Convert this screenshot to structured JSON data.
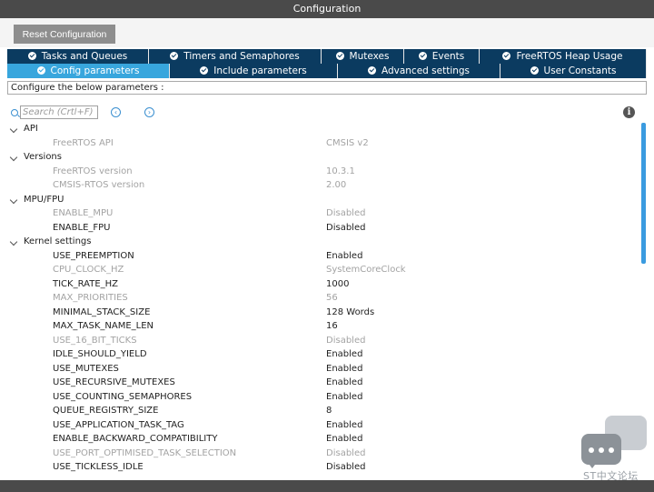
{
  "window": {
    "title": "Configuration"
  },
  "toolbar": {
    "reset_label": "Reset Configuration"
  },
  "tabs_row1": [
    {
      "label": "Tasks and Queues"
    },
    {
      "label": "Timers and Semaphores"
    },
    {
      "label": "Mutexes"
    },
    {
      "label": "Events"
    },
    {
      "label": "FreeRTOS Heap Usage"
    }
  ],
  "tabs_row2": [
    {
      "label": "Config parameters",
      "active": true
    },
    {
      "label": "Include parameters"
    },
    {
      "label": "Advanced settings"
    },
    {
      "label": "User Constants"
    }
  ],
  "info_text": "Configure the below parameters :",
  "search": {
    "placeholder": "Search (Crtl+F)"
  },
  "tree": [
    {
      "type": "group",
      "label": "API"
    },
    {
      "type": "param",
      "name": "FreeRTOS API",
      "value": "CMSIS v2",
      "enabled": false
    },
    {
      "type": "group",
      "label": "Versions"
    },
    {
      "type": "param",
      "name": "FreeRTOS version",
      "value": "10.3.1",
      "enabled": false
    },
    {
      "type": "param",
      "name": "CMSIS-RTOS version",
      "value": "2.00",
      "enabled": false
    },
    {
      "type": "group",
      "label": "MPU/FPU"
    },
    {
      "type": "param",
      "name": "ENABLE_MPU",
      "value": "Disabled",
      "enabled": false
    },
    {
      "type": "param",
      "name": "ENABLE_FPU",
      "value": "Disabled",
      "enabled": true
    },
    {
      "type": "group",
      "label": "Kernel settings"
    },
    {
      "type": "param",
      "name": "USE_PREEMPTION",
      "value": "Enabled",
      "enabled": true
    },
    {
      "type": "param",
      "name": "CPU_CLOCK_HZ",
      "value": "SystemCoreClock",
      "enabled": false
    },
    {
      "type": "param",
      "name": "TICK_RATE_HZ",
      "value": "1000",
      "enabled": true
    },
    {
      "type": "param",
      "name": "MAX_PRIORITIES",
      "value": "56",
      "enabled": false
    },
    {
      "type": "param",
      "name": "MINIMAL_STACK_SIZE",
      "value": "128 Words",
      "enabled": true
    },
    {
      "type": "param",
      "name": "MAX_TASK_NAME_LEN",
      "value": "16",
      "enabled": true
    },
    {
      "type": "param",
      "name": "USE_16_BIT_TICKS",
      "value": "Disabled",
      "enabled": false
    },
    {
      "type": "param",
      "name": "IDLE_SHOULD_YIELD",
      "value": "Enabled",
      "enabled": true
    },
    {
      "type": "param",
      "name": "USE_MUTEXES",
      "value": "Enabled",
      "enabled": true
    },
    {
      "type": "param",
      "name": "USE_RECURSIVE_MUTEXES",
      "value": "Enabled",
      "enabled": true
    },
    {
      "type": "param",
      "name": "USE_COUNTING_SEMAPHORES",
      "value": "Enabled",
      "enabled": true
    },
    {
      "type": "param",
      "name": "QUEUE_REGISTRY_SIZE",
      "value": "8",
      "enabled": true
    },
    {
      "type": "param",
      "name": "USE_APPLICATION_TASK_TAG",
      "value": "Enabled",
      "enabled": true
    },
    {
      "type": "param",
      "name": "ENABLE_BACKWARD_COMPATIBILITY",
      "value": "Enabled",
      "enabled": true
    },
    {
      "type": "param",
      "name": "USE_PORT_OPTIMISED_TASK_SELECTION",
      "value": "Disabled",
      "enabled": false
    },
    {
      "type": "param",
      "name": "USE_TICKLESS_IDLE",
      "value": "Disabled",
      "enabled": true
    }
  ],
  "watermark": {
    "text": "ST中文论坛"
  },
  "colors": {
    "tab_bg": "#0b3b60",
    "tab_active": "#38a6dd",
    "accent": "#3a9be0"
  }
}
